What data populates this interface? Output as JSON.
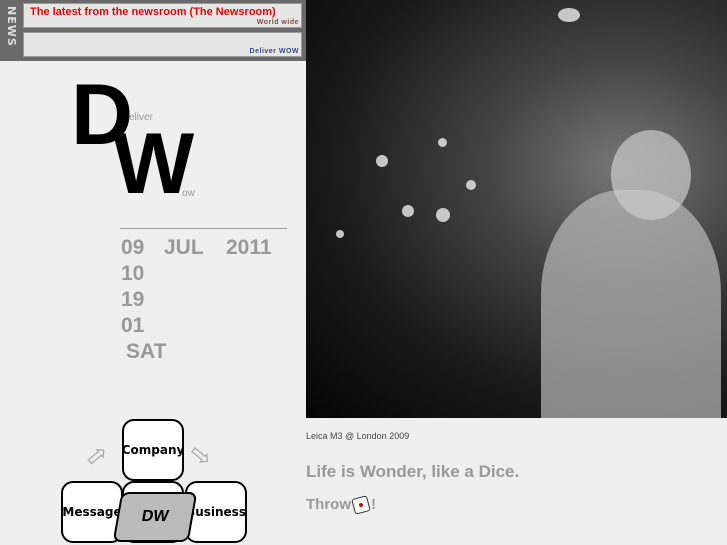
{
  "news": {
    "tab_label": "NEWS",
    "headline": "The latest from the newsroom (The Newsroom)",
    "tag1": "World wide",
    "tag2": "Deliver WOW",
    "tag1_color": "#8a4a4a",
    "tag2_color": "#3a4a80"
  },
  "logo": {
    "big_d": "D",
    "big_w": "W",
    "sub1": "eliver",
    "sub2": "ow"
  },
  "date": {
    "day": "09",
    "month": "JUL",
    "year": "2011",
    "line2": "10",
    "line3": "19",
    "line4": "01",
    "weekday": "SAT"
  },
  "photo": {
    "caption": "Leica M3 @ London 2009"
  },
  "slogan": "Life is Wonder, like a Dice.",
  "throw": {
    "label": "Throw",
    "suffix": "!"
  },
  "diagram": {
    "top": "Company",
    "left": "Message",
    "right": "Business",
    "center": "DW"
  }
}
